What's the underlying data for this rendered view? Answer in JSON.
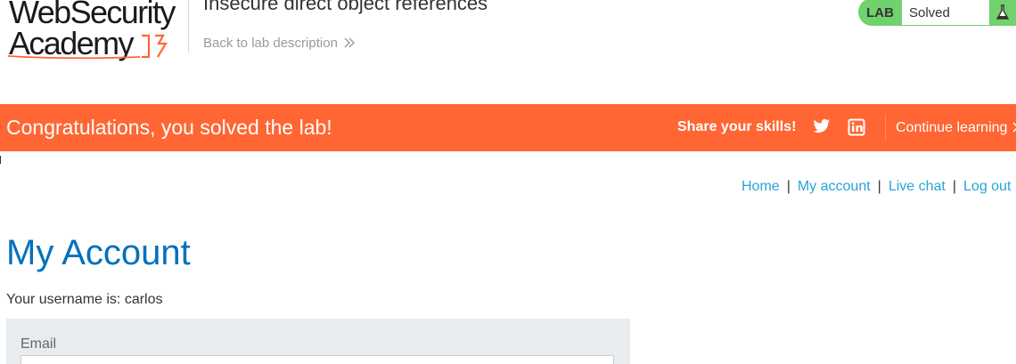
{
  "header": {
    "logo": {
      "line1": "WebSecurity",
      "line2": "Academy"
    },
    "lab_title": "Insecure direct object references",
    "back_link": "Back to lab description",
    "lab_badge": "LAB",
    "lab_state": "Solved"
  },
  "banner": {
    "message": "Congratulations, you solved the lab!",
    "share_label": "Share your skills!",
    "continue_label": "Continue learning"
  },
  "nav": {
    "items": [
      "Home",
      "My account",
      "Live chat",
      "Log out"
    ],
    "separator": "|"
  },
  "main": {
    "title": "My Account",
    "username_line": "Your username is: carlos",
    "email_label": "Email",
    "email_value": ""
  },
  "colors": {
    "accent_orange": "#ff6633",
    "solved_green": "#70d16d",
    "title_blue": "#0071bc",
    "link_blue": "#29a4d9"
  }
}
